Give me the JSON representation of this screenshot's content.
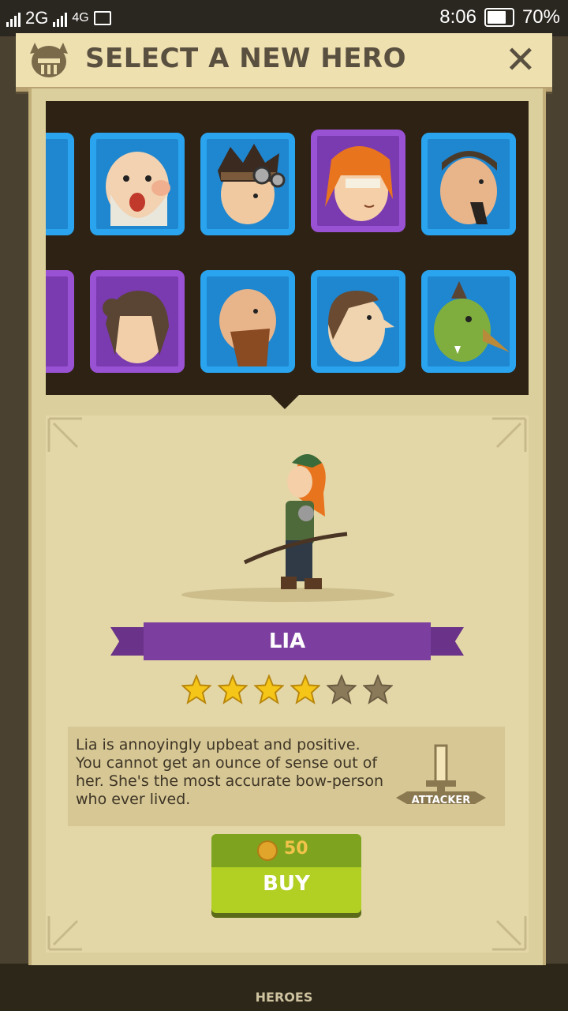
{
  "status_bar": {
    "network1": "2G",
    "network2": "4G",
    "time": "8:06",
    "battery": "70%"
  },
  "header": {
    "title": "SELECT A NEW HERO",
    "close_label": "✕"
  },
  "hero_grid": {
    "row1": [
      {
        "name": "partial-hero",
        "frame": "blue"
      },
      {
        "name": "bald-old-man",
        "frame": "blue"
      },
      {
        "name": "goggles-boy",
        "frame": "blue"
      },
      {
        "name": "lia",
        "frame": "purple",
        "selected": true
      },
      {
        "name": "bearded-man",
        "frame": "blue"
      }
    ],
    "row2": [
      {
        "name": "partial-hero",
        "frame": "purple"
      },
      {
        "name": "brown-haired-girl",
        "frame": "purple"
      },
      {
        "name": "big-bearded-man",
        "frame": "blue"
      },
      {
        "name": "pale-man",
        "frame": "blue"
      },
      {
        "name": "green-goblin",
        "frame": "blue"
      }
    ]
  },
  "hero": {
    "name": "LIA",
    "stars_filled": 4,
    "stars_total": 6,
    "description": "Lia is annoyingly upbeat and positive. You cannot get an ounce of sense out of her. She's the most accurate bow-person who ever lived.",
    "class": "ATTACKER"
  },
  "buy": {
    "price": "50",
    "label": "BUY"
  },
  "bottom_nav": {
    "heroes": "HEROES"
  },
  "colors": {
    "blue_frame": "#2aa4ee",
    "purple_frame": "#9a52d4",
    "ribbon": "#7c3f9f",
    "buy": "#b2cf24"
  }
}
